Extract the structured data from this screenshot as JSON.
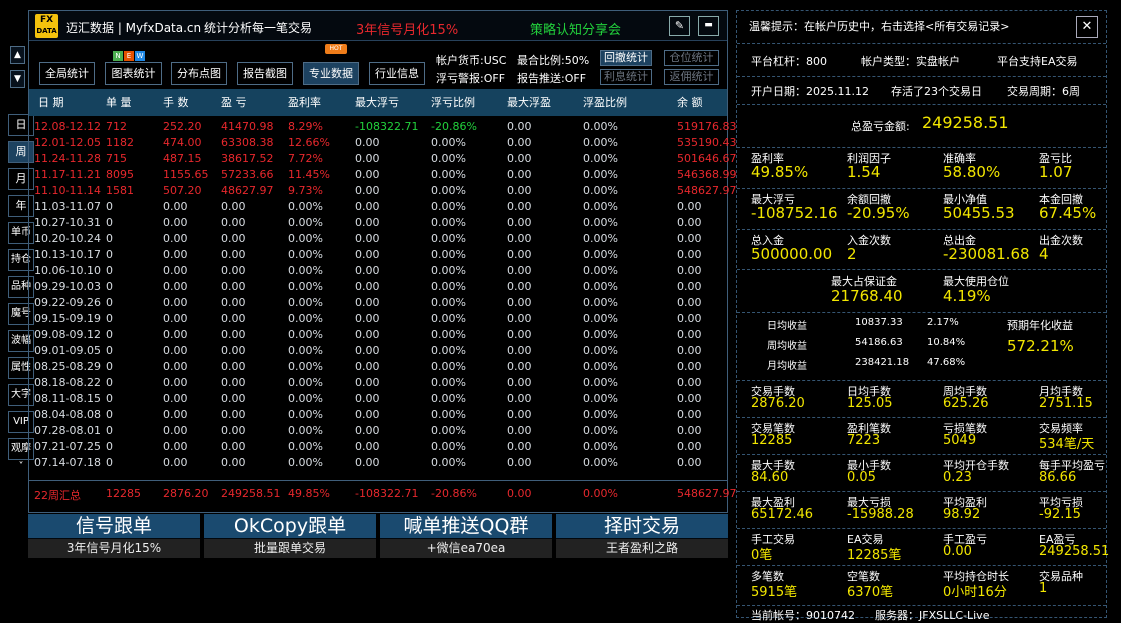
{
  "side_nav": {
    "arrow_up": "▲",
    "arrow_down": "▼",
    "items": [
      "日",
      "周",
      "月",
      "年",
      "单币",
      "持仓",
      "品种",
      "魔号",
      "波幅",
      "属性",
      "大字",
      "VIP",
      "观摩"
    ],
    "expand": "˅",
    "active": "周"
  },
  "header": {
    "logo_top": "FX",
    "logo_bottom": "DATA",
    "brand": "迈汇数据 | MyfxData.cn",
    "slogan": "统计分析每一笔交易",
    "promo": "3年信号月化15%",
    "share": "策略认知分享会",
    "edit_icon": "✎",
    "min_icon": "▬"
  },
  "toolbar": {
    "buttons": [
      "全局统计",
      "图表统计",
      "分布点图",
      "报告截图",
      "专业数据",
      "行业信息"
    ],
    "active": "专业数据",
    "new_badge": [
      "N",
      "E",
      "W"
    ],
    "hot_badge": "HOT"
  },
  "status": {
    "currency": "帐户货币:USC",
    "max_ratio": "最合比例:50%",
    "float_alert": "浮亏警报:OFF",
    "report_push": "报告推送:OFF",
    "btn_withdraw": "回撤统计",
    "btn_position": "仓位统计",
    "btn_interest": "利息统计",
    "btn_rebate": "返佣统计"
  },
  "table": {
    "headers": [
      "日 期",
      "单 量",
      "手 数",
      "盈 亏",
      "盈利率",
      "最大浮亏",
      "浮亏比例",
      "最大浮盈",
      "浮盈比例",
      "余 额"
    ],
    "rows": [
      [
        "12.08-12.12",
        "712",
        "252.20",
        "41470.98",
        "8.29%",
        "-108322.71",
        "-20.86%",
        "0.00",
        "0.00%",
        "519176.83"
      ],
      [
        "12.01-12.05",
        "1182",
        "474.00",
        "63308.38",
        "12.66%",
        "0.00",
        "0.00%",
        "0.00",
        "0.00%",
        "535190.43"
      ],
      [
        "11.24-11.28",
        "715",
        "487.15",
        "38617.52",
        "7.72%",
        "0.00",
        "0.00%",
        "0.00",
        "0.00%",
        "501646.67"
      ],
      [
        "11.17-11.21",
        "8095",
        "1155.65",
        "57233.66",
        "11.45%",
        "0.00",
        "0.00%",
        "0.00",
        "0.00%",
        "546368.99"
      ],
      [
        "11.10-11.14",
        "1581",
        "507.20",
        "48627.97",
        "9.73%",
        "0.00",
        "0.00%",
        "0.00",
        "0.00%",
        "548627.97"
      ],
      [
        "11.03-11.07",
        "0",
        "0.00",
        "0.00",
        "0.00%",
        "0.00",
        "0.00%",
        "0.00",
        "0.00%",
        "0.00"
      ],
      [
        "10.27-10.31",
        "0",
        "0.00",
        "0.00",
        "0.00%",
        "0.00",
        "0.00%",
        "0.00",
        "0.00%",
        "0.00"
      ],
      [
        "10.20-10.24",
        "0",
        "0.00",
        "0.00",
        "0.00%",
        "0.00",
        "0.00%",
        "0.00",
        "0.00%",
        "0.00"
      ],
      [
        "10.13-10.17",
        "0",
        "0.00",
        "0.00",
        "0.00%",
        "0.00",
        "0.00%",
        "0.00",
        "0.00%",
        "0.00"
      ],
      [
        "10.06-10.10",
        "0",
        "0.00",
        "0.00",
        "0.00%",
        "0.00",
        "0.00%",
        "0.00",
        "0.00%",
        "0.00"
      ],
      [
        "09.29-10.03",
        "0",
        "0.00",
        "0.00",
        "0.00%",
        "0.00",
        "0.00%",
        "0.00",
        "0.00%",
        "0.00"
      ],
      [
        "09.22-09.26",
        "0",
        "0.00",
        "0.00",
        "0.00%",
        "0.00",
        "0.00%",
        "0.00",
        "0.00%",
        "0.00"
      ],
      [
        "09.15-09.19",
        "0",
        "0.00",
        "0.00",
        "0.00%",
        "0.00",
        "0.00%",
        "0.00",
        "0.00%",
        "0.00"
      ],
      [
        "09.08-09.12",
        "0",
        "0.00",
        "0.00",
        "0.00%",
        "0.00",
        "0.00%",
        "0.00",
        "0.00%",
        "0.00"
      ],
      [
        "09.01-09.05",
        "0",
        "0.00",
        "0.00",
        "0.00%",
        "0.00",
        "0.00%",
        "0.00",
        "0.00%",
        "0.00"
      ],
      [
        "08.25-08.29",
        "0",
        "0.00",
        "0.00",
        "0.00%",
        "0.00",
        "0.00%",
        "0.00",
        "0.00%",
        "0.00"
      ],
      [
        "08.18-08.22",
        "0",
        "0.00",
        "0.00",
        "0.00%",
        "0.00",
        "0.00%",
        "0.00",
        "0.00%",
        "0.00"
      ],
      [
        "08.11-08.15",
        "0",
        "0.00",
        "0.00",
        "0.00%",
        "0.00",
        "0.00%",
        "0.00",
        "0.00%",
        "0.00"
      ],
      [
        "08.04-08.08",
        "0",
        "0.00",
        "0.00",
        "0.00%",
        "0.00",
        "0.00%",
        "0.00",
        "0.00%",
        "0.00"
      ],
      [
        "07.28-08.01",
        "0",
        "0.00",
        "0.00",
        "0.00%",
        "0.00",
        "0.00%",
        "0.00",
        "0.00%",
        "0.00"
      ],
      [
        "07.21-07.25",
        "0",
        "0.00",
        "0.00",
        "0.00%",
        "0.00",
        "0.00%",
        "0.00",
        "0.00%",
        "0.00"
      ],
      [
        "07.14-07.18",
        "0",
        "0.00",
        "0.00",
        "0.00%",
        "0.00",
        "0.00%",
        "0.00",
        "0.00%",
        "0.00"
      ]
    ],
    "summary": [
      "22周汇总",
      "12285",
      "2876.20",
      "249258.51",
      "49.85%",
      "-108322.71",
      "-20.86%",
      "0.00",
      "0.00%",
      "548627.97"
    ]
  },
  "promo_buttons": [
    {
      "title": "信号跟单",
      "sub": "3年信号月化15%"
    },
    {
      "title": "OkCopy跟单",
      "sub": "批量跟单交易"
    },
    {
      "title": "喊单推送QQ群",
      "sub": "+微信ea70ea"
    },
    {
      "title": "择时交易",
      "sub": "王者盈利之路"
    }
  ],
  "right_panel": {
    "tip": "温馨提示：在帐户历史中，右击选择<所有交易记录>",
    "close_icon": "✕",
    "leverage": "平台杠杆：800",
    "account_type": "帐户类型：实盘帐户",
    "ea_support": "平台支持EA交易",
    "open_date": "开户日期：2025.11.12",
    "survived": "存活了23个交易日",
    "cycle": "交易周期：6周",
    "total_label": "总盈亏金额:",
    "total_value": "249258.51",
    "grid1": [
      {
        "label": "盈利率",
        "value": "49.85%"
      },
      {
        "label": "利润因子",
        "value": "1.54"
      },
      {
        "label": "准确率",
        "value": "58.80%"
      },
      {
        "label": "盈亏比",
        "value": "1.07"
      },
      {
        "label": "最大浮亏",
        "value": "-108752.16"
      },
      {
        "label": "余额回撤",
        "value": "-20.95%"
      },
      {
        "label": "最小净值",
        "value": "50455.53"
      },
      {
        "label": "本金回撤",
        "value": "67.45%"
      },
      {
        "label": "总入金",
        "value": "500000.00"
      },
      {
        "label": "入金次数",
        "value": "2"
      },
      {
        "label": "总出金",
        "value": "-230081.68"
      },
      {
        "label": "出金次数",
        "value": "4"
      }
    ],
    "margin_label": "最大占保证金",
    "margin_value": "21768.40",
    "usage_label": "最大使用仓位",
    "usage_value": "4.19%",
    "returns": [
      {
        "label": "日均收益",
        "amount": "10837.33",
        "pct": "2.17%"
      },
      {
        "label": "周均收益",
        "amount": "54186.63",
        "pct": "10.84%"
      },
      {
        "label": "月均收益",
        "amount": "238421.18",
        "pct": "47.68%"
      }
    ],
    "annual_label": "预期年化收益",
    "annual_value": "572.21%",
    "grid2": [
      {
        "label": "交易手数",
        "value": "2876.20"
      },
      {
        "label": "日均手数",
        "value": "125.05"
      },
      {
        "label": "周均手数",
        "value": "625.26"
      },
      {
        "label": "月均手数",
        "value": "2751.15"
      },
      {
        "label": "交易笔数",
        "value": "12285"
      },
      {
        "label": "盈利笔数",
        "value": "7223"
      },
      {
        "label": "亏损笔数",
        "value": "5049"
      },
      {
        "label": "交易频率",
        "value": "534笔/天"
      },
      {
        "label": "最大手数",
        "value": "84.60"
      },
      {
        "label": "最小手数",
        "value": "0.05"
      },
      {
        "label": "平均开仓手数",
        "value": "0.23"
      },
      {
        "label": "每手平均盈亏",
        "value": "86.66"
      },
      {
        "label": "最大盈利",
        "value": "65172.46"
      },
      {
        "label": "最大亏损",
        "value": "-15988.28"
      },
      {
        "label": "平均盈利",
        "value": "98.92"
      },
      {
        "label": "平均亏损",
        "value": "-92.15"
      },
      {
        "label": "手工交易",
        "value": "0笔"
      },
      {
        "label": "EA交易",
        "value": "12285笔"
      },
      {
        "label": "手工盈亏",
        "value": "0.00"
      },
      {
        "label": "EA盈亏",
        "value": "249258.51"
      },
      {
        "label": "多笔数",
        "value": "5915笔"
      },
      {
        "label": "空笔数",
        "value": "6370笔"
      },
      {
        "label": "平均持仓时长",
        "value": "0小时16分"
      },
      {
        "label": "交易品种",
        "value": "1"
      }
    ],
    "account_no": "当前帐号：9010742",
    "server": "服务器：JFXSLLC-Live"
  }
}
